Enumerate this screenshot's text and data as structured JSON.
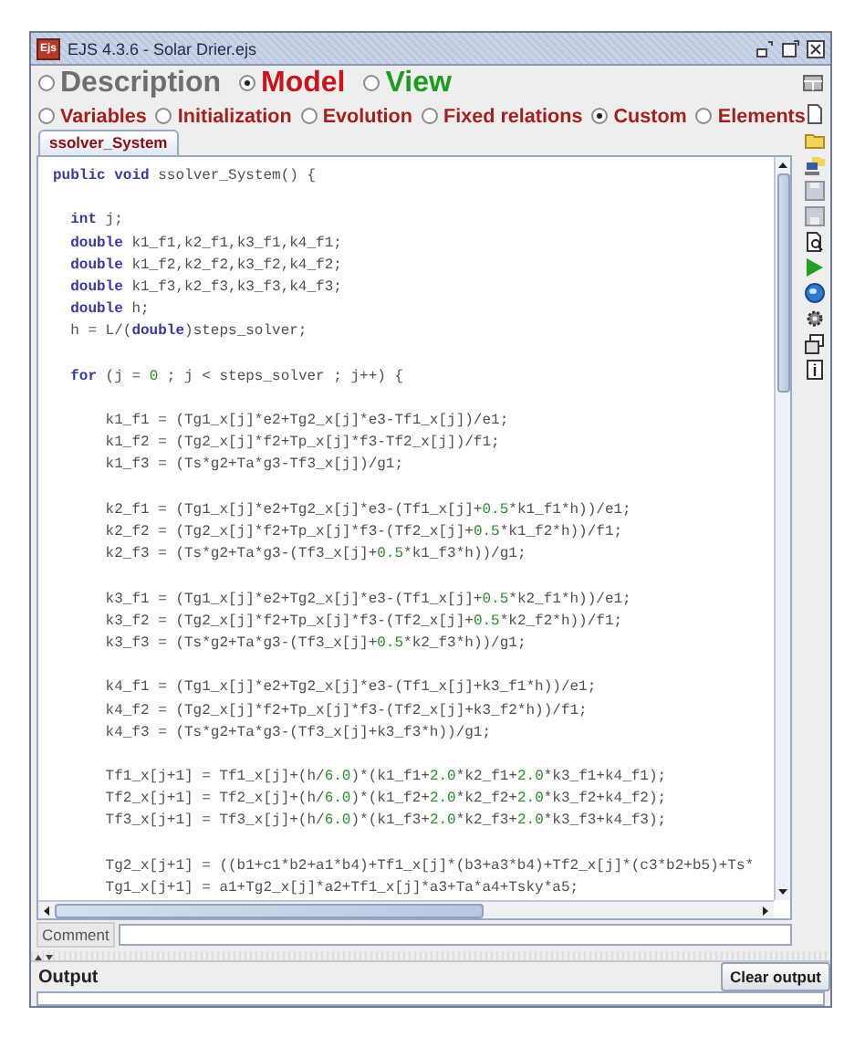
{
  "window": {
    "app_icon": "Ejs",
    "title": "EJS 4.3.6 - Solar Drier.ejs"
  },
  "main_tabs": [
    {
      "label": "Description",
      "selected": false,
      "color": "#6e6e6e"
    },
    {
      "label": "Model",
      "selected": true,
      "color": "#c4161c"
    },
    {
      "label": "View",
      "selected": false,
      "color": "#1f9a1f"
    }
  ],
  "sub_tabs": [
    {
      "label": "Variables",
      "selected": false
    },
    {
      "label": "Initialization",
      "selected": false
    },
    {
      "label": "Evolution",
      "selected": false
    },
    {
      "label": "Fixed relations",
      "selected": false
    },
    {
      "label": "Custom",
      "selected": true
    },
    {
      "label": "Elements",
      "selected": false
    }
  ],
  "page_tabs": [
    {
      "label": "ssolver_System",
      "selected": true
    }
  ],
  "editor": {
    "lines": [
      {
        "kind": "code",
        "segments": [
          {
            "kind": "keyword",
            "text": "public"
          },
          {
            "kind": "keyword",
            "text": " void"
          },
          {
            "kind": "plain",
            "text": " ssolver_System() {"
          }
        ],
        "children": [
          {
            "kind": "blank"
          },
          {
            "kind": "code",
            "segments": [
              {
                "kind": "keyword",
                "text": "int"
              },
              {
                "kind": "plain",
                "text": " j;"
              }
            ]
          },
          {
            "kind": "code",
            "segments": [
              {
                "kind": "keyword",
                "text": "double"
              },
              {
                "kind": "plain",
                "text": " k1_f1,k2_f1,k3_f1,k4_f1;"
              }
            ]
          },
          {
            "kind": "code",
            "segments": [
              {
                "kind": "keyword",
                "text": "double"
              },
              {
                "kind": "plain",
                "text": " k1_f2,k2_f2,k3_f2,k4_f2;"
              }
            ]
          },
          {
            "kind": "code",
            "segments": [
              {
                "kind": "keyword",
                "text": "double"
              },
              {
                "kind": "plain",
                "text": " k1_f3,k2_f3,k3_f3,k4_f3;"
              }
            ]
          },
          {
            "kind": "code",
            "segments": [
              {
                "kind": "keyword",
                "text": "double"
              },
              {
                "kind": "plain",
                "text": " h;"
              }
            ]
          },
          {
            "kind": "code",
            "segments": [
              {
                "kind": "plain",
                "text": "h = L/("
              },
              {
                "kind": "keyword",
                "text": "double"
              },
              {
                "kind": "plain",
                "text": ")steps_solver;"
              }
            ]
          },
          {
            "kind": "blank"
          },
          {
            "kind": "code",
            "segments": [
              {
                "kind": "keyword",
                "text": "for"
              },
              {
                "kind": "plain",
                "text": " (j = "
              },
              {
                "kind": "number",
                "text": "0"
              },
              {
                "kind": "plain",
                "text": " ; j < steps_solver ; j++) {"
              }
            ],
            "children": [
              {
                "kind": "blank"
              },
              {
                "kind": "code",
                "segments": [
                  {
                    "kind": "plain",
                    "text": "k1_f1 = (Tg1_x[j]*e2+Tg2_x[j]*e3-Tf1_x[j])/e1;"
                  }
                ]
              },
              {
                "kind": "code",
                "segments": [
                  {
                    "kind": "plain",
                    "text": "k1_f2 = (Tg2_x[j]*f2+Tp_x[j]*f3-Tf2_x[j])/f1;"
                  }
                ]
              },
              {
                "kind": "code",
                "segments": [
                  {
                    "kind": "plain",
                    "text": "k1_f3 = (Ts*g2+Ta*g3-Tf3_x[j])/g1;"
                  }
                ]
              },
              {
                "kind": "blank"
              },
              {
                "kind": "code",
                "segments": [
                  {
                    "kind": "plain",
                    "text": "k2_f1 = (Tg1_x[j]*e2+Tg2_x[j]*e3-(Tf1_x[j]+"
                  },
                  {
                    "kind": "number",
                    "text": "0.5"
                  },
                  {
                    "kind": "plain",
                    "text": "*k1_f1*h))/e1;"
                  }
                ]
              },
              {
                "kind": "code",
                "segments": [
                  {
                    "kind": "plain",
                    "text": "k2_f2 = (Tg2_x[j]*f2+Tp_x[j]*f3-(Tf2_x[j]+"
                  },
                  {
                    "kind": "number",
                    "text": "0.5"
                  },
                  {
                    "kind": "plain",
                    "text": "*k1_f2*h))/f1;"
                  }
                ]
              },
              {
                "kind": "code",
                "segments": [
                  {
                    "kind": "plain",
                    "text": "k2_f3 = (Ts*g2+Ta*g3-(Tf3_x[j]+"
                  },
                  {
                    "kind": "number",
                    "text": "0.5"
                  },
                  {
                    "kind": "plain",
                    "text": "*k1_f3*h))/g1;"
                  }
                ]
              },
              {
                "kind": "blank"
              },
              {
                "kind": "code",
                "segments": [
                  {
                    "kind": "plain",
                    "text": "k3_f1 = (Tg1_x[j]*e2+Tg2_x[j]*e3-(Tf1_x[j]+"
                  },
                  {
                    "kind": "number",
                    "text": "0.5"
                  },
                  {
                    "kind": "plain",
                    "text": "*k2_f1*h))/e1;"
                  }
                ]
              },
              {
                "kind": "code",
                "segments": [
                  {
                    "kind": "plain",
                    "text": "k3_f2 = (Tg2_x[j]*f2+Tp_x[j]*f3-(Tf2_x[j]+"
                  },
                  {
                    "kind": "number",
                    "text": "0.5"
                  },
                  {
                    "kind": "plain",
                    "text": "*k2_f2*h))/f1;"
                  }
                ]
              },
              {
                "kind": "code",
                "segments": [
                  {
                    "kind": "plain",
                    "text": "k3_f3 = (Ts*g2+Ta*g3-(Tf3_x[j]+"
                  },
                  {
                    "kind": "number",
                    "text": "0.5"
                  },
                  {
                    "kind": "plain",
                    "text": "*k2_f3*h))/g1;"
                  }
                ]
              },
              {
                "kind": "blank"
              },
              {
                "kind": "code",
                "segments": [
                  {
                    "kind": "plain",
                    "text": "k4_f1 = (Tg1_x[j]*e2+Tg2_x[j]*e3-(Tf1_x[j]+k3_f1*h))/e1;"
                  }
                ]
              },
              {
                "kind": "code",
                "segments": [
                  {
                    "kind": "plain",
                    "text": "k4_f2 = (Tg2_x[j]*f2+Tp_x[j]*f3-(Tf2_x[j]+k3_f2*h))/f1;"
                  }
                ]
              },
              {
                "kind": "code",
                "segments": [
                  {
                    "kind": "plain",
                    "text": "k4_f3 = (Ts*g2+Ta*g3-(Tf3_x[j]+k3_f3*h))/g1;"
                  }
                ]
              },
              {
                "kind": "blank"
              },
              {
                "kind": "code",
                "segments": [
                  {
                    "kind": "plain",
                    "text": "Tf1_x[j+1] = Tf1_x[j]+(h/"
                  },
                  {
                    "kind": "number",
                    "text": "6.0"
                  },
                  {
                    "kind": "plain",
                    "text": ")*(k1_f1+"
                  },
                  {
                    "kind": "number",
                    "text": "2.0"
                  },
                  {
                    "kind": "plain",
                    "text": "*k2_f1+"
                  },
                  {
                    "kind": "number",
                    "text": "2.0"
                  },
                  {
                    "kind": "plain",
                    "text": "*k3_f1+k4_f1);"
                  }
                ]
              },
              {
                "kind": "code",
                "segments": [
                  {
                    "kind": "plain",
                    "text": "Tf2_x[j+1] = Tf2_x[j]+(h/"
                  },
                  {
                    "kind": "number",
                    "text": "6.0"
                  },
                  {
                    "kind": "plain",
                    "text": ")*(k1_f2+"
                  },
                  {
                    "kind": "number",
                    "text": "2.0"
                  },
                  {
                    "kind": "plain",
                    "text": "*k2_f2+"
                  },
                  {
                    "kind": "number",
                    "text": "2.0"
                  },
                  {
                    "kind": "plain",
                    "text": "*k3_f2+k4_f2);"
                  }
                ]
              },
              {
                "kind": "code",
                "segments": [
                  {
                    "kind": "plain",
                    "text": "Tf3_x[j+1] = Tf3_x[j]+(h/"
                  },
                  {
                    "kind": "number",
                    "text": "6.0"
                  },
                  {
                    "kind": "plain",
                    "text": ")*(k1_f3+"
                  },
                  {
                    "kind": "number",
                    "text": "2.0"
                  },
                  {
                    "kind": "plain",
                    "text": "*k2_f3+"
                  },
                  {
                    "kind": "number",
                    "text": "2.0"
                  },
                  {
                    "kind": "plain",
                    "text": "*k3_f3+k4_f3);"
                  }
                ]
              },
              {
                "kind": "blank"
              },
              {
                "kind": "code",
                "segments": [
                  {
                    "kind": "plain",
                    "text": "Tg2_x[j+1] = ((b1+c1*b2+a1*b4)+Tf1_x[j]*(b3+a3*b4)+Tf2_x[j]*(c3*b2+b5)+Ts*"
                  }
                ]
              },
              {
                "kind": "code",
                "segments": [
                  {
                    "kind": "plain",
                    "text": "Tg1_x[j+1] = a1+Tg2_x[j]*a2+Tf1_x[j]*a3+Ta*a4+Tsky*a5;"
                  }
                ]
              }
            ]
          }
        ]
      }
    ]
  },
  "comment": {
    "label": "Comment"
  },
  "output": {
    "title": "Output",
    "clear_button": "Clear output"
  }
}
